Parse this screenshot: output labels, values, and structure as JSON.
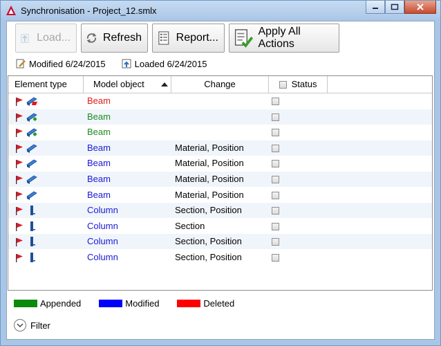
{
  "window": {
    "title": "Synchronisation - Project_12.smlx"
  },
  "toolbar": {
    "load_label": "Load...",
    "refresh_label": "Refresh",
    "report_label": "Report...",
    "apply_label": "Apply All Actions"
  },
  "info": {
    "modified_label": "Modified",
    "modified_date": "6/24/2015",
    "loaded_label": "Loaded",
    "loaded_date": "6/24/2015"
  },
  "grid": {
    "columns": {
      "element_type": "Element type",
      "model_object": "Model object",
      "change": "Change",
      "status": "Status"
    },
    "rows": [
      {
        "object": "Beam",
        "kind": "deleted",
        "change": "",
        "icon": "beam-deleted-icon"
      },
      {
        "object": "Beam",
        "kind": "appended",
        "change": "",
        "icon": "beam-appended-icon"
      },
      {
        "object": "Beam",
        "kind": "appended",
        "change": "",
        "icon": "beam-appended-icon"
      },
      {
        "object": "Beam",
        "kind": "modified",
        "change": "Material, Position",
        "icon": "beam-modified-icon"
      },
      {
        "object": "Beam",
        "kind": "modified",
        "change": "Material, Position",
        "icon": "beam-modified-icon"
      },
      {
        "object": "Beam",
        "kind": "modified",
        "change": "Material, Position",
        "icon": "beam-modified-icon"
      },
      {
        "object": "Beam",
        "kind": "modified",
        "change": "Material, Position",
        "icon": "beam-modified-icon"
      },
      {
        "object": "Column",
        "kind": "modified",
        "change": "Section, Position",
        "icon": "column-icon"
      },
      {
        "object": "Column",
        "kind": "modified",
        "change": "Section",
        "icon": "column-icon"
      },
      {
        "object": "Column",
        "kind": "modified",
        "change": "Section, Position",
        "icon": "column-icon"
      },
      {
        "object": "Column",
        "kind": "modified",
        "change": "Section, Position",
        "icon": "column-icon"
      }
    ]
  },
  "legend": {
    "appended": "Appended",
    "modified": "Modified",
    "deleted": "Deleted"
  },
  "filter": {
    "label": "Filter"
  },
  "colors": {
    "appended": "#1f8a1f",
    "modified": "#1a1ad6",
    "deleted": "#e01b1b",
    "appended_swatch": "#0b8a0b",
    "modified_swatch": "#0000ff",
    "deleted_swatch": "#ff0000"
  }
}
